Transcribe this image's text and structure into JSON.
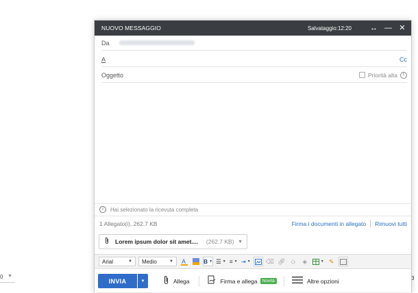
{
  "background": {
    "left_number": "0",
    "right_char": "3"
  },
  "titlebar": {
    "title": "NUOVO MESSAGGIO",
    "saved": "Salvataggio:12:20",
    "expand_icon": "↔",
    "minimize_icon": "—",
    "close_icon": "✕"
  },
  "fields": {
    "from_label": "Da",
    "to_label": "A",
    "cc_label": "Cc",
    "subject_label": "Oggetto",
    "priority_label": "Priorità alta"
  },
  "receipt_text": "Hai selezionato la ricevuta completa",
  "attachments": {
    "summary": "1 Allegato(i), 262.7 KB",
    "sign_docs": "Firma i documenti in allegato",
    "remove_all": "Rimuovi tutti",
    "file_name": "Lorem ipsum dolor sit amet....",
    "file_size": "(262.7 KB)"
  },
  "format_toolbar": {
    "font": "Arial",
    "size": "Medio",
    "bold": "B"
  },
  "send_bar": {
    "send_label": "INVIA",
    "attach_label": "Allega",
    "sign_attach_label": "Firma e allega",
    "new_badge": "Novità",
    "more_options_label": "Altre opzioni"
  },
  "colors": {
    "titlebar_bg": "#3a3d41",
    "send_button": "#2f6dc8",
    "link": "#2a6fc9",
    "new_badge": "#4caf50"
  }
}
